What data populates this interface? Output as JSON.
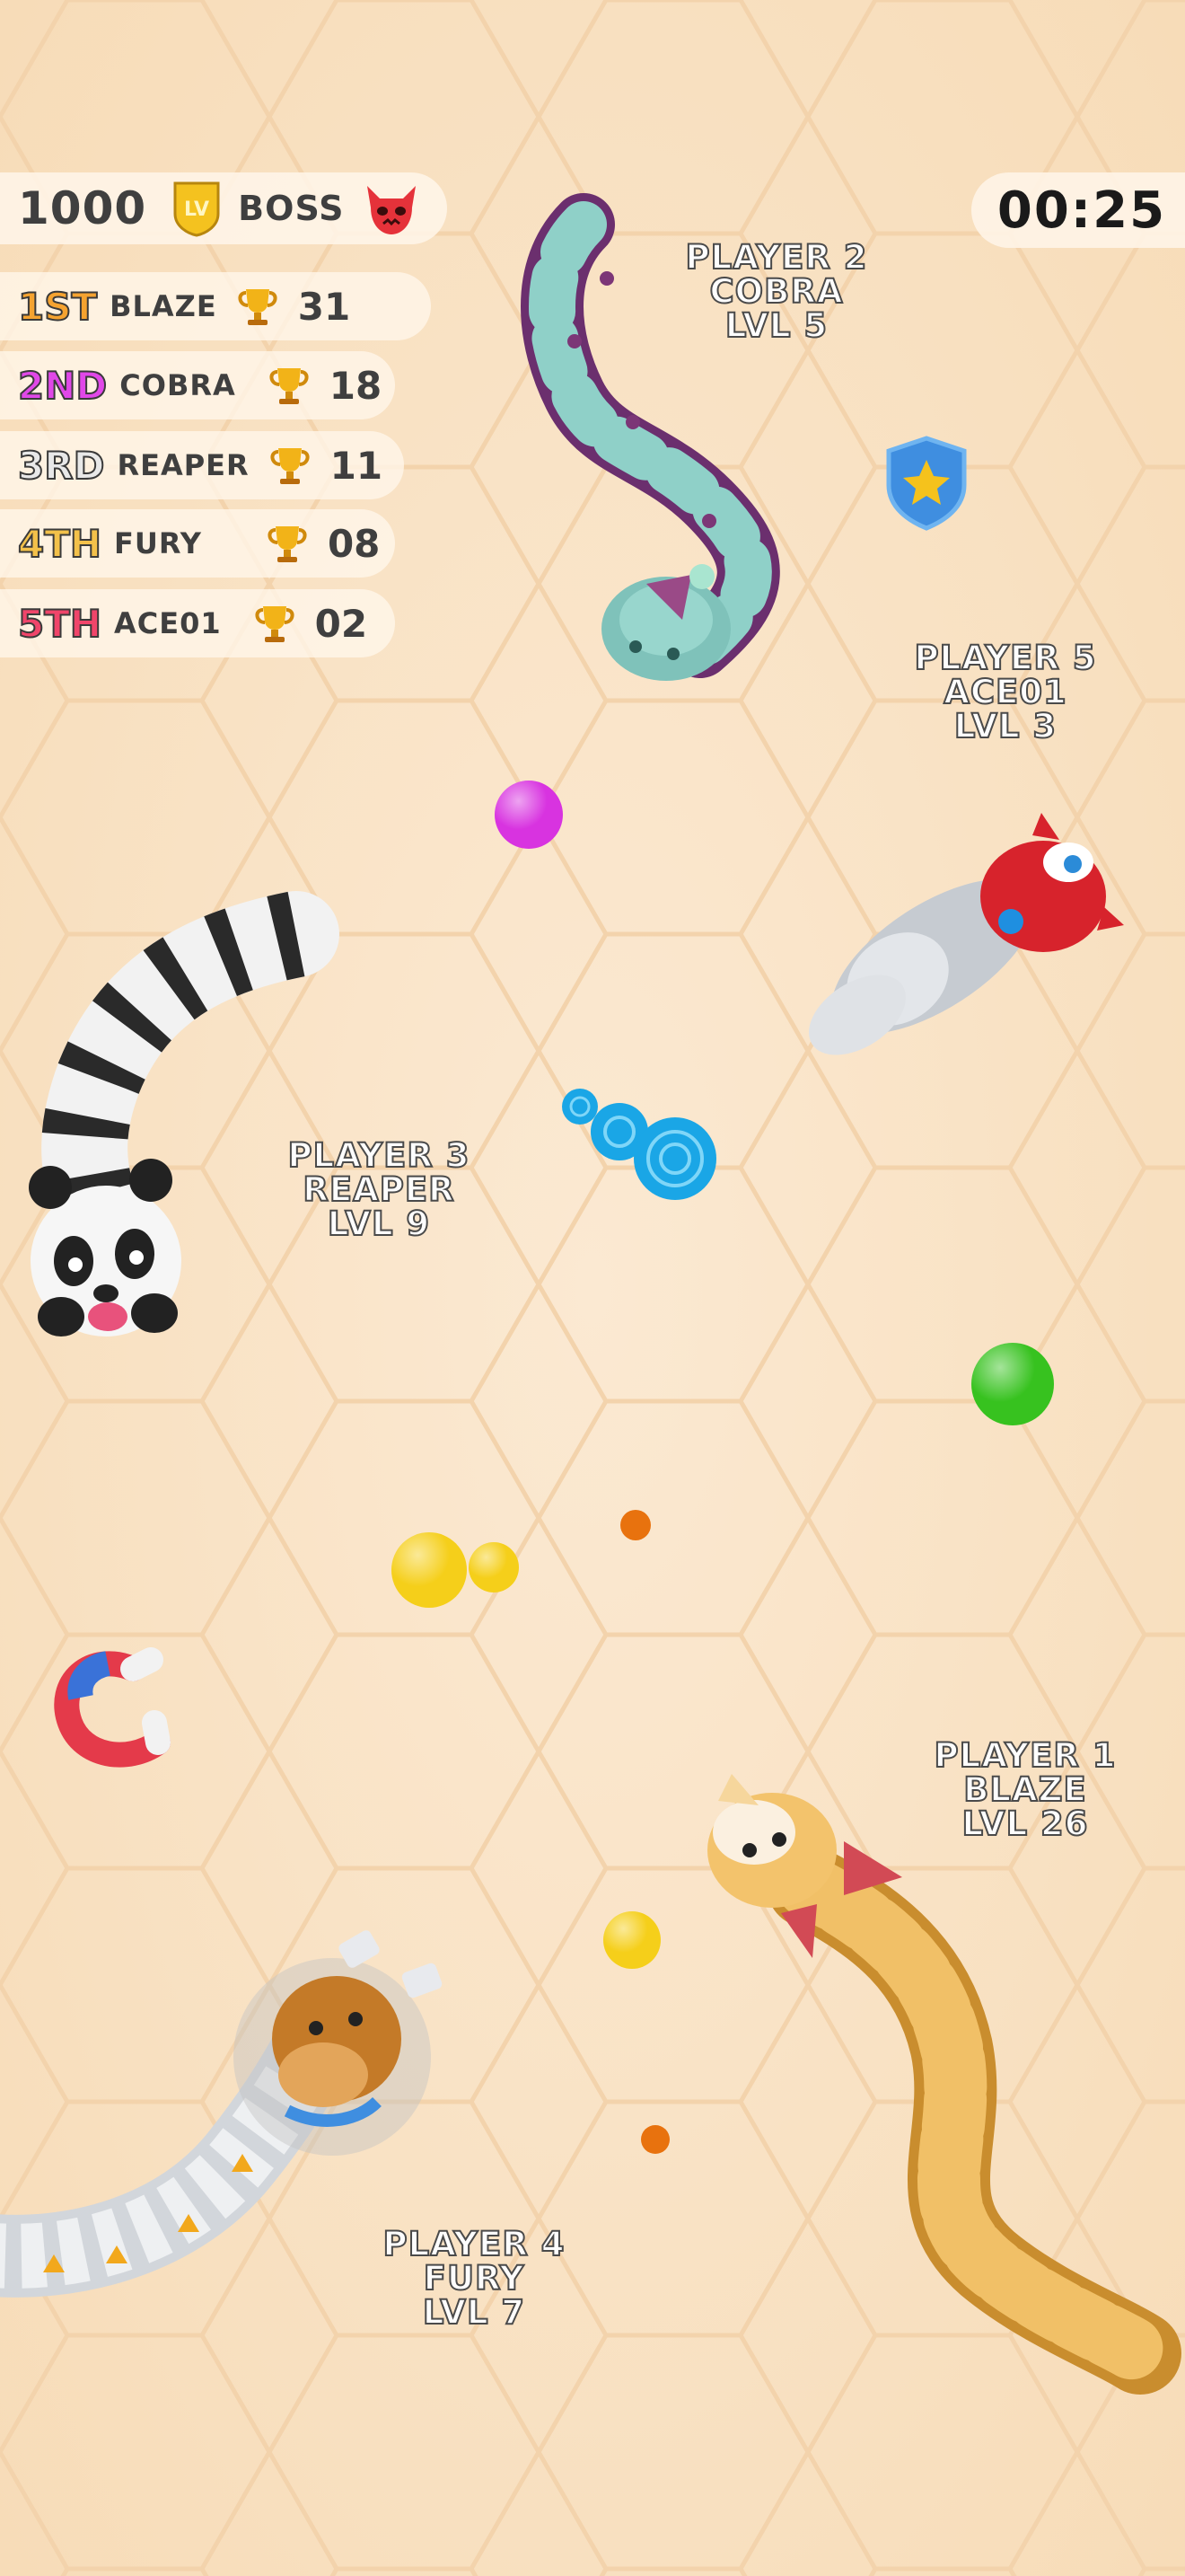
{
  "hud": {
    "score": "1000",
    "lv_badge_text": "LV",
    "boss_label": "BOSS",
    "timer": "00:25"
  },
  "leaderboard": [
    {
      "rank": "1ST",
      "name": "BLAZE",
      "score": "31",
      "color": "#f5a330"
    },
    {
      "rank": "2ND",
      "name": "COBRA",
      "score": "18",
      "color": "#e048e8"
    },
    {
      "rank": "3RD",
      "name": "REAPER",
      "score": "11",
      "color": "#e8e8e8"
    },
    {
      "rank": "4TH",
      "name": "FURY",
      "score": "08",
      "color": "#f3c14a"
    },
    {
      "rank": "5TH",
      "name": "ACE01",
      "score": "02",
      "color": "#f0456a"
    }
  ],
  "players": {
    "p2": {
      "line1": "PLAYER 2",
      "line2": "COBRA",
      "line3": "LVL 5"
    },
    "p5": {
      "line1": "PLAYER  5",
      "line2": "ACE01",
      "line3": "LVL 3"
    },
    "p3": {
      "line1": "PLAYER  3",
      "line2": "REAPER",
      "line3": "LVL 9"
    },
    "p1": {
      "line1": "PLAYER  1",
      "line2": "BLAZE",
      "line3": "LVL 26"
    },
    "p4": {
      "line1": "PLAYER  4",
      "line2": "FURY",
      "line3": "LVL 7"
    }
  },
  "items": {
    "shield_icon": "shield-star-icon",
    "magnet_icon": "magnet-icon"
  },
  "colors": {
    "background": "#f9e3c6",
    "food_magenta": "#d833e0",
    "food_green": "#37c21f",
    "food_yellow": "#f5cf1a",
    "food_orange": "#e8720e",
    "food_blue": "#1aa6e6"
  }
}
